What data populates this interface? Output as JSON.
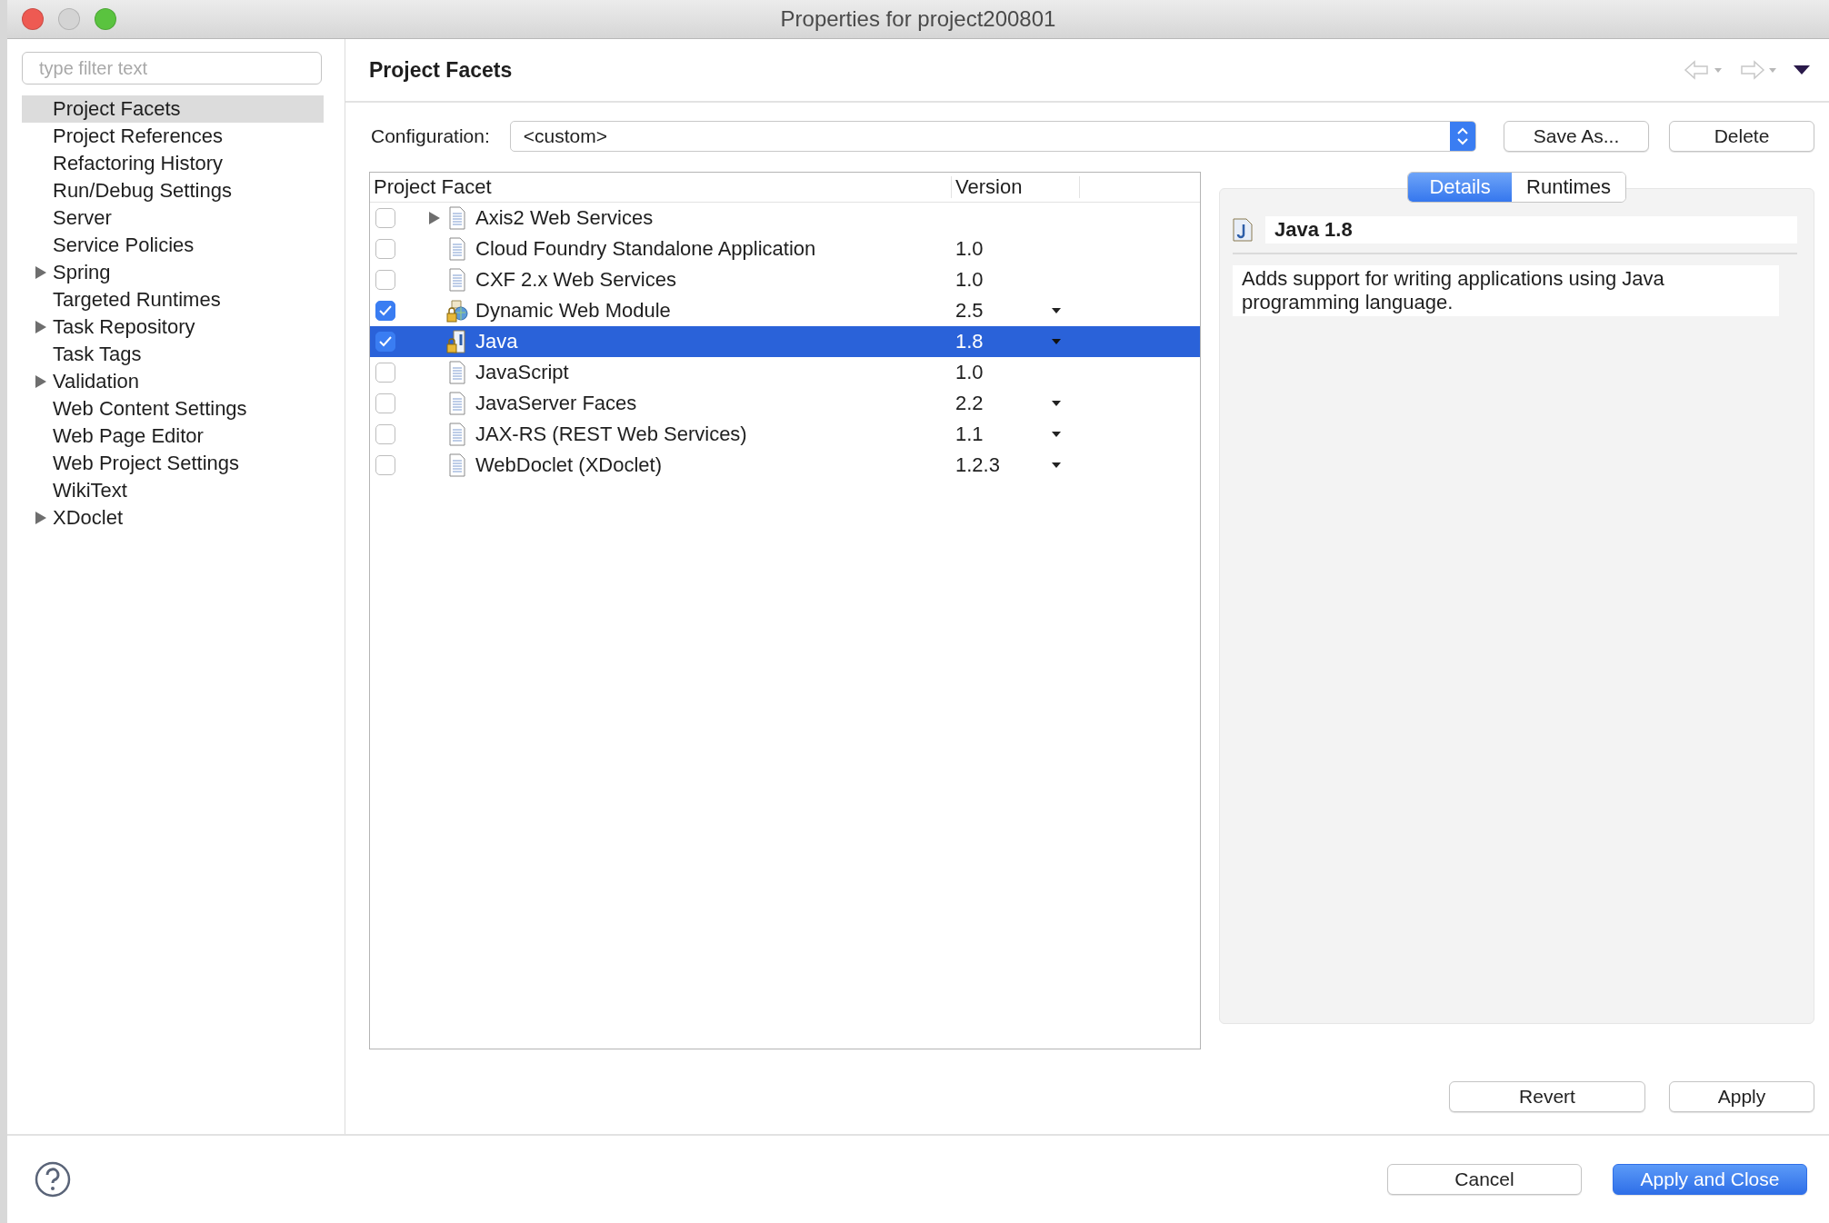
{
  "window": {
    "title": "Properties for project200801"
  },
  "filter": {
    "placeholder": "type filter text"
  },
  "sidebar": {
    "items": [
      {
        "label": "Project Facets",
        "selected": true,
        "expandable": false
      },
      {
        "label": "Project References",
        "selected": false,
        "expandable": false
      },
      {
        "label": "Refactoring History",
        "selected": false,
        "expandable": false
      },
      {
        "label": "Run/Debug Settings",
        "selected": false,
        "expandable": false
      },
      {
        "label": "Server",
        "selected": false,
        "expandable": false
      },
      {
        "label": "Service Policies",
        "selected": false,
        "expandable": false
      },
      {
        "label": "Spring",
        "selected": false,
        "expandable": true
      },
      {
        "label": "Targeted Runtimes",
        "selected": false,
        "expandable": false
      },
      {
        "label": "Task Repository",
        "selected": false,
        "expandable": true
      },
      {
        "label": "Task Tags",
        "selected": false,
        "expandable": false
      },
      {
        "label": "Validation",
        "selected": false,
        "expandable": true
      },
      {
        "label": "Web Content Settings",
        "selected": false,
        "expandable": false
      },
      {
        "label": "Web Page Editor",
        "selected": false,
        "expandable": false
      },
      {
        "label": "Web Project Settings",
        "selected": false,
        "expandable": false
      },
      {
        "label": "WikiText",
        "selected": false,
        "expandable": false
      },
      {
        "label": "XDoclet",
        "selected": false,
        "expandable": true
      }
    ]
  },
  "page": {
    "title": "Project Facets"
  },
  "configuration": {
    "label": "Configuration:",
    "value": "<custom>",
    "buttons": [
      "Save As...",
      "Delete"
    ]
  },
  "table": {
    "columns": [
      "Project Facet",
      "Version"
    ],
    "rows": [
      {
        "name": "Axis2 Web Services",
        "version": null,
        "kind": "document",
        "checked": false,
        "selected": false,
        "expandable": true,
        "dropdown": false
      },
      {
        "name": "Cloud Foundry Standalone Application",
        "version": "1.0",
        "kind": "document",
        "checked": false,
        "selected": false,
        "expandable": false,
        "dropdown": false
      },
      {
        "name": "CXF 2.x Web Services",
        "version": "1.0",
        "kind": "document",
        "checked": false,
        "selected": false,
        "expandable": false,
        "dropdown": false
      },
      {
        "name": "Dynamic Web Module",
        "version": "2.5",
        "kind": "web-module",
        "checked": true,
        "selected": false,
        "expandable": false,
        "dropdown": true
      },
      {
        "name": "Java",
        "version": "1.8",
        "kind": "java",
        "checked": true,
        "selected": true,
        "expandable": false,
        "dropdown": true
      },
      {
        "name": "JavaScript",
        "version": "1.0",
        "kind": "document",
        "checked": false,
        "selected": false,
        "expandable": false,
        "dropdown": false
      },
      {
        "name": "JavaServer Faces",
        "version": "2.2",
        "kind": "document",
        "checked": false,
        "selected": false,
        "expandable": false,
        "dropdown": true
      },
      {
        "name": "JAX-RS (REST Web Services)",
        "version": "1.1",
        "kind": "document",
        "checked": false,
        "selected": false,
        "expandable": false,
        "dropdown": true
      },
      {
        "name": "WebDoclet (XDoclet)",
        "version": "1.2.3",
        "kind": "document",
        "checked": false,
        "selected": false,
        "expandable": false,
        "dropdown": true
      }
    ]
  },
  "details": {
    "tabs": [
      {
        "label": "Details",
        "selected": true
      },
      {
        "label": "Runtimes",
        "selected": false
      }
    ],
    "title": "Java 1.8",
    "description": "Adds support for writing applications using Java programming language."
  },
  "page_buttons": [
    "Revert",
    "Apply"
  ],
  "footer": {
    "cancel": "Cancel",
    "primary": "Apply and Close"
  }
}
